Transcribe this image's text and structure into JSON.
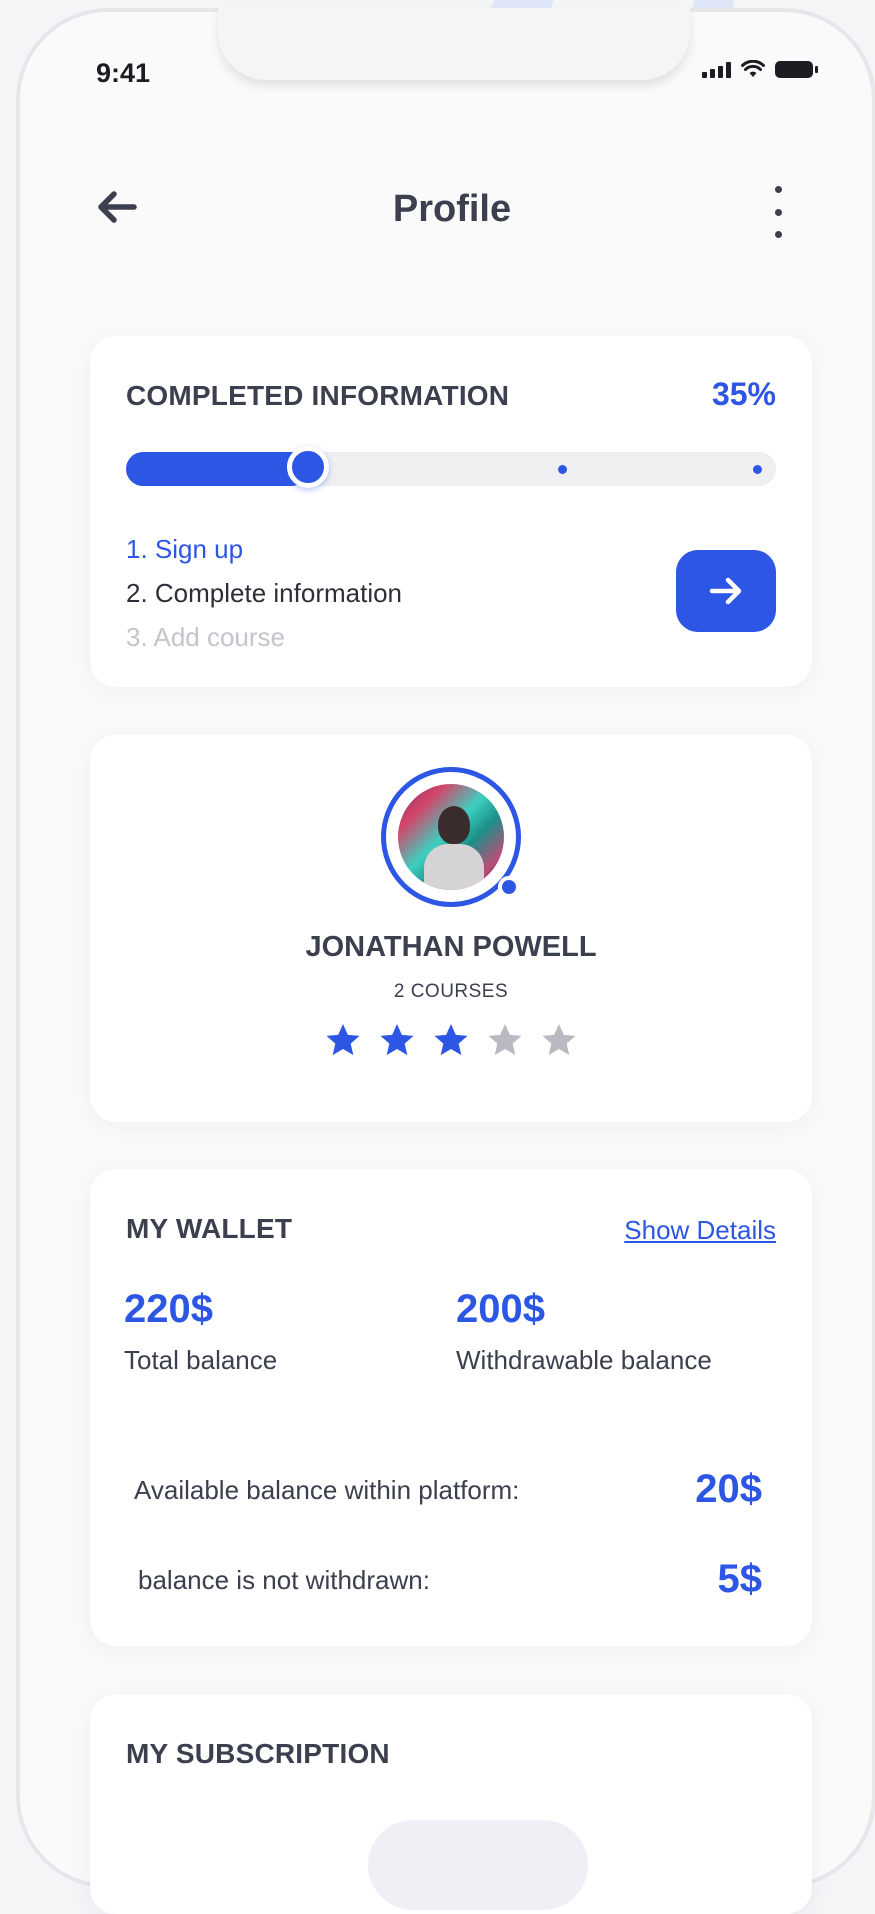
{
  "status_bar": {
    "time": "9:41"
  },
  "header": {
    "title": "Profile"
  },
  "completion": {
    "heading": "COMPLETED INFORMATION",
    "percent_label": "35%",
    "progress_fraction": 0.28,
    "steps": [
      "1. Sign up",
      "2. Complete information",
      "3. Add course"
    ]
  },
  "profile": {
    "name": "JONATHAN POWELL",
    "courses": "2 COURSES",
    "rating": 3,
    "rating_max": 5
  },
  "wallet": {
    "heading": "MY WALLET",
    "show_details": "Show Details",
    "total_amount": "220$",
    "total_label": "Total balance",
    "withdrawable_amount": "200$",
    "withdrawable_label": "Withdrawable balance",
    "available_label": "Available balance within platform:",
    "available_amount": "20$",
    "not_withdrawn_label": "balance is not withdrawn:",
    "not_withdrawn_amount": "5$"
  },
  "subscription": {
    "heading": "MY SUBSCRIPTION"
  },
  "colors": {
    "accent": "#2c56e3",
    "text": "#3b3f4e",
    "muted": "#c3c5cc",
    "star_off": "#b9bac1"
  }
}
